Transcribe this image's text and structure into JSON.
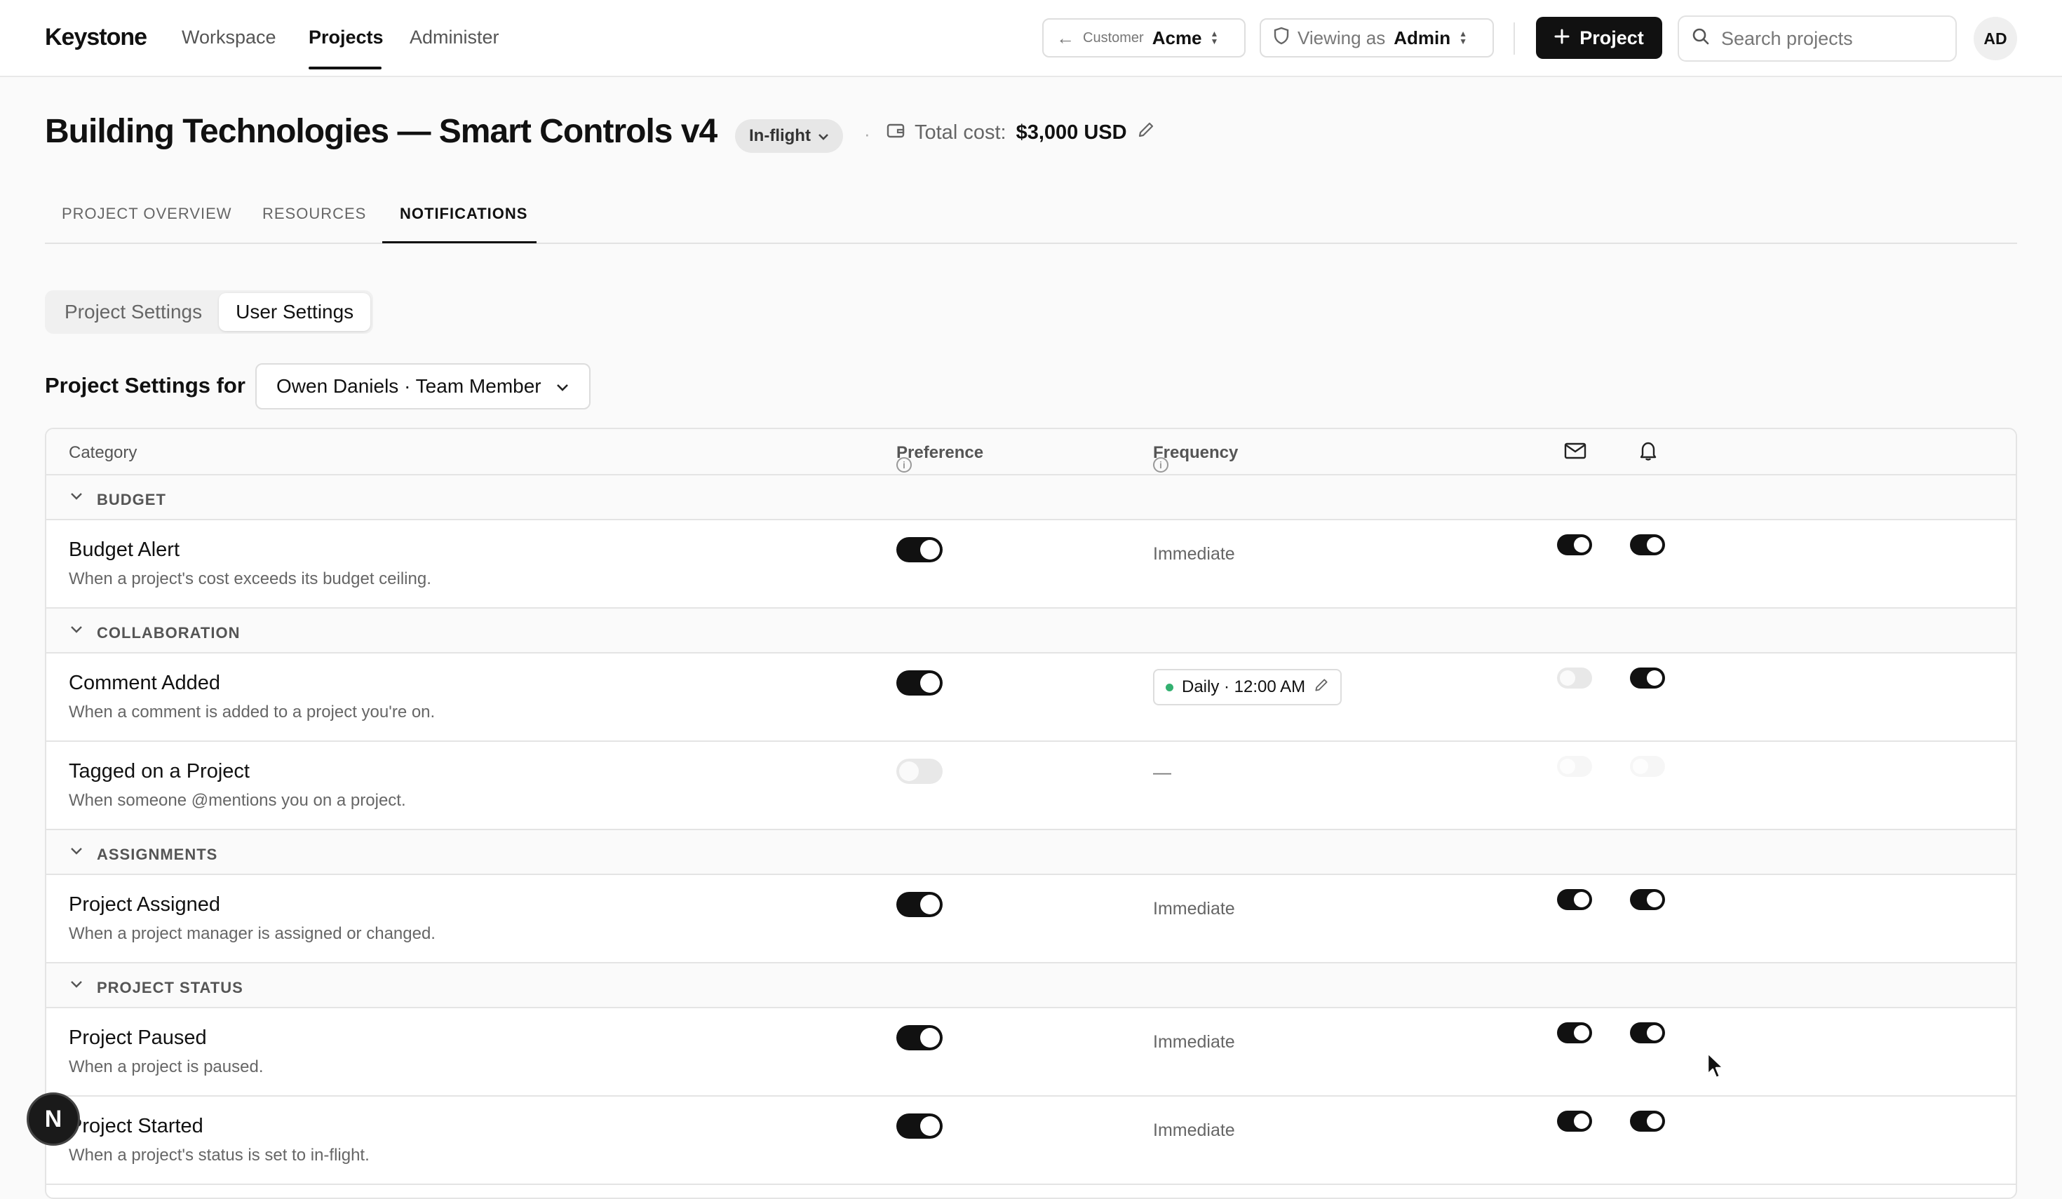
{
  "app": {
    "logo": "Keystone"
  },
  "nav": {
    "items": [
      {
        "label": "Workspace"
      },
      {
        "label": "Projects"
      },
      {
        "label": "Administer"
      }
    ],
    "active": "Projects"
  },
  "customer_switch": {
    "back_arrow": "←",
    "label": "Customer",
    "value": "Acme"
  },
  "viewing_as": {
    "label": "Viewing as",
    "value": "Admin"
  },
  "new_project_button": {
    "label": "Project"
  },
  "search": {
    "placeholder": "Search projects"
  },
  "user": {
    "initials": "AD"
  },
  "project": {
    "title": "Building Technologies — Smart Controls v4",
    "status": "In-flight",
    "separator": "·",
    "cost_label": "Total cost:",
    "cost_value": "$3,000 USD"
  },
  "tabs": [
    {
      "label": "PROJECT OVERVIEW"
    },
    {
      "label": "RESOURCES"
    },
    {
      "label": "NOTIFICATIONS"
    }
  ],
  "active_tab": "NOTIFICATIONS",
  "settings_toggle": {
    "options": [
      {
        "label": "Project Settings"
      },
      {
        "label": "User Settings"
      }
    ],
    "active": "User Settings"
  },
  "settings_for": {
    "label": "Project Settings for",
    "selected_user": "Owen Daniels · Team Member"
  },
  "table": {
    "headers": {
      "category": "Category",
      "preference": "Preference",
      "frequency": "Frequency",
      "email_icon": "mail-icon",
      "push_icon": "bell-icon"
    },
    "groups": [
      {
        "label": "BUDGET",
        "rows": [
          {
            "name": "Budget Alert",
            "description": "When a project's cost exceeds its budget ceiling.",
            "preference": true,
            "frequency": "Immediate",
            "email": true,
            "push": true
          }
        ]
      },
      {
        "label": "COLLABORATION",
        "rows": [
          {
            "name": "Comment Added",
            "description": "When a comment is added to a project you're on.",
            "preference": true,
            "frequency": "Daily · 12:00 AM",
            "email": false,
            "push": true
          },
          {
            "name": "Tagged on a Project",
            "description": "When someone @mentions you on a project.",
            "preference": false,
            "frequency": "—",
            "email": false,
            "push": false
          }
        ]
      },
      {
        "label": "ASSIGNMENTS",
        "rows": [
          {
            "name": "Project Assigned",
            "description": "When a project manager is assigned or changed.",
            "preference": true,
            "frequency": "Immediate",
            "email": true,
            "push": true
          }
        ]
      },
      {
        "label": "PROJECT STATUS",
        "rows": [
          {
            "name": "Project Paused",
            "description": "When a project is paused.",
            "preference": true,
            "frequency": "Immediate",
            "email": true,
            "push": true
          },
          {
            "name": "Project Started",
            "description": "When a project's status is set to in-flight.",
            "preference": true,
            "frequency": "Immediate",
            "email": true,
            "push": true
          }
        ]
      }
    ]
  },
  "fab": {
    "label": "N"
  },
  "colors": {
    "accent": "#111111",
    "status_green": "#33b070",
    "background": "#fafafa"
  }
}
